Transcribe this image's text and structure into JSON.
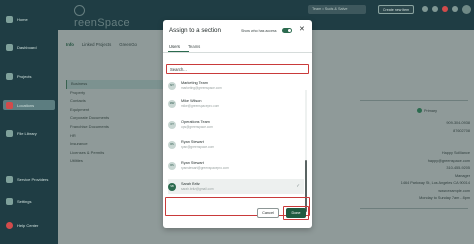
{
  "sidebar": {
    "items": [
      {
        "label": "Home",
        "icon": "home-icon"
      },
      {
        "label": "Dashboard",
        "icon": "dashboard-icon"
      },
      {
        "label": "Projects",
        "icon": "projects-icon"
      },
      {
        "label": "Locations",
        "icon": "location-icon",
        "active": true
      },
      {
        "label": "File Library",
        "icon": "file-icon"
      },
      {
        "label": "Service Providers",
        "icon": "provider-icon"
      },
      {
        "label": "Settings",
        "icon": "gear-icon"
      },
      {
        "label": "Help Center",
        "icon": "help-icon"
      }
    ]
  },
  "topbar": {
    "logo_text": "reenSpace",
    "business_select": "Team • Suds & Salve",
    "new_button": "Create new item"
  },
  "location_tabs": [
    "Info",
    "Linked Projects",
    "GreenGo"
  ],
  "subnav": [
    "Business",
    "Property",
    "Contacts",
    "Equipment",
    "Corporate Documents",
    "Franchise Documents",
    "HR",
    "Insurance",
    "Licenses & Permits",
    "Utilities"
  ],
  "right_details": {
    "primary_label": "Primary",
    "lines": [
      "909-304-0938",
      "",
      "87602708",
      "",
      "",
      "Happy Scilliance",
      "happy@greenspace.com",
      "310-455-9205",
      "Manager",
      "1464 Parkway St, Los Angeles CA 90014",
      "www.example.com",
      "Monday to Sunday 7am - 8pm"
    ]
  },
  "modal": {
    "title": "Assign to a section",
    "access_label": "Show who has access",
    "close_icon": "close-icon",
    "tabs": [
      "Users",
      "Teams"
    ],
    "search_placeholder": "Search...",
    "users": [
      {
        "initials": "MT",
        "name": "Marketing Team",
        "email": "marketing@greenspace.com"
      },
      {
        "initials": "MW",
        "name": "Mike Wilson",
        "email": "mike@greenspacepro.com"
      },
      {
        "initials": "OT",
        "name": "Operations Team",
        "email": "ops@greenspace.com"
      },
      {
        "initials": "RS",
        "name": "Ryan Stewart",
        "email": "ryan@greenspace.com"
      },
      {
        "initials": "RS",
        "name": "Ryan Stewart",
        "email": "ryanstewart@greenspacepro.com"
      },
      {
        "initials": "SB",
        "name": "Sarah Britz",
        "email": "sarah.britz@gmail.com",
        "selected": true
      }
    ],
    "cancel_label": "Cancel",
    "done_label": "Done"
  },
  "colors": {
    "sidebar_bg": "#1f3d44",
    "accent_green": "#2c6b4f",
    "highlight_red": "#c93a3a"
  }
}
